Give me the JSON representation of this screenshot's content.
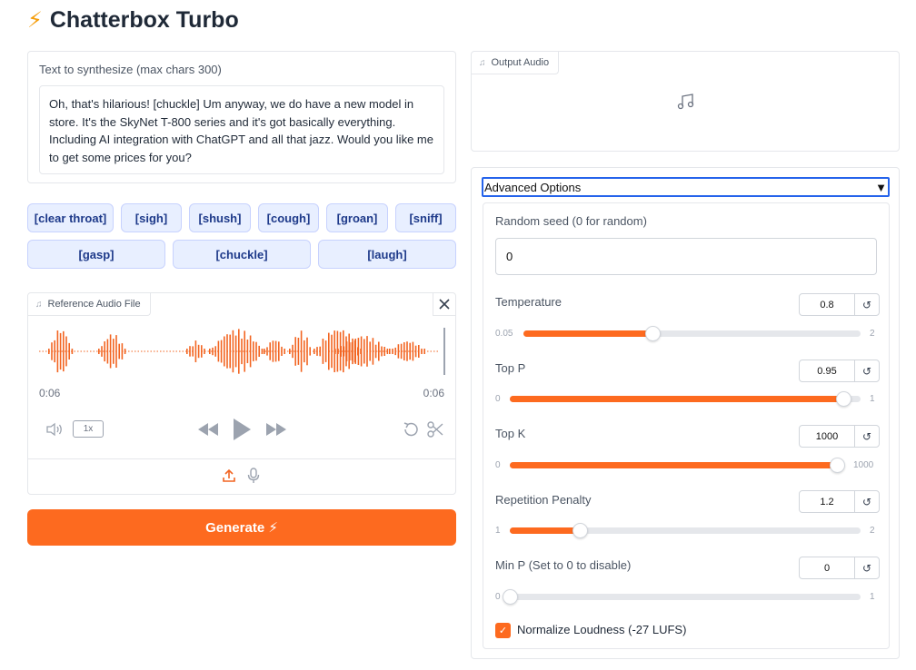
{
  "app": {
    "title": "Chatterbox Turbo",
    "title_icon": "⚡"
  },
  "text_input": {
    "label": "Text to synthesize (max chars 300)",
    "value": "Oh, that's hilarious! [chuckle] Um anyway, we do have a new model in store. It's the SkyNet T-800 series and it's got basically everything. Including AI integration with ChatGPT and all that jazz. Would you like me to get some prices for you?"
  },
  "tags": [
    "[clear throat]",
    "[sigh]",
    "[shush]",
    "[cough]",
    "[groan]",
    "[sniff]",
    "[gasp]",
    "[chuckle]",
    "[laugh]"
  ],
  "reference_audio": {
    "label": "Reference Audio File",
    "time_current": "0:06",
    "time_total": "0:06",
    "speed": "1x",
    "wave_color": "#f26522"
  },
  "generate": {
    "label": "Generate ⚡",
    "color": "#fd6a1f"
  },
  "output_audio": {
    "label": "Output Audio"
  },
  "advanced": {
    "title": "Advanced Options",
    "seed": {
      "label": "Random seed (0 for random)",
      "value": "0"
    },
    "temperature": {
      "label": "Temperature",
      "value": "0.8",
      "min": "0.05",
      "max": "2",
      "fraction": 0.384
    },
    "top_p": {
      "label": "Top P",
      "value": "0.95",
      "min": "0",
      "max": "1",
      "fraction": 0.95
    },
    "top_k": {
      "label": "Top K",
      "value": "1000",
      "min": "0",
      "max": "1000",
      "fraction": 1.0
    },
    "repetition_penalty": {
      "label": "Repetition Penalty",
      "value": "1.2",
      "min": "1",
      "max": "2",
      "fraction": 0.2
    },
    "min_p": {
      "label": "Min P (Set to 0 to disable)",
      "value": "0",
      "min": "0",
      "max": "1",
      "fraction": 0.0
    },
    "normalize": {
      "label": "Normalize Loudness (-27 LUFS)",
      "checked": true
    }
  }
}
